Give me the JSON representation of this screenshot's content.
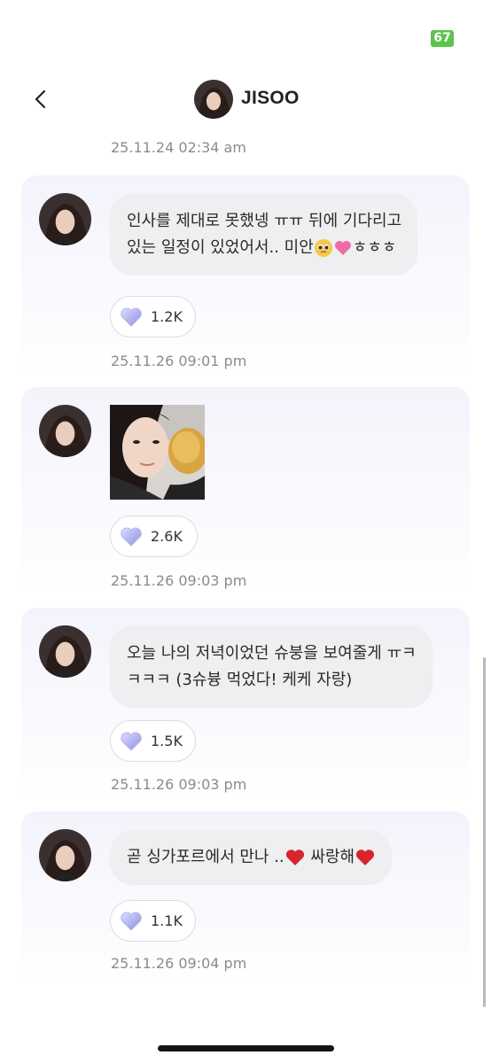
{
  "status": {
    "battery": "67"
  },
  "header": {
    "name": "JISOO"
  },
  "top_timestamp": "25.11.24 02:34 am",
  "messages": [
    {
      "type": "text",
      "lines": [
        "인사를 제대로 못했넹 ㅠㅠ 뒤에 기다리고",
        "있는 일정이 있었어서.. 미안"
      ],
      "tail": "ㅎㅎㅎ",
      "likes": "1.2K",
      "timestamp": "25.11.26 09:01 pm"
    },
    {
      "type": "image",
      "likes": "2.6K",
      "timestamp": "25.11.26 09:03 pm"
    },
    {
      "type": "text",
      "lines": [
        "오늘 나의 저녁이었던 슈붕을 보여줄게 ㅠㅋ",
        "ㅋㅋㅋ (3슈븅 먹었다! 케케 자랑)"
      ],
      "likes": "1.5K",
      "timestamp": "25.11.26 09:03 pm"
    },
    {
      "type": "text",
      "lines": [
        "곧 싱가포르에서 만나 .."
      ],
      "tail": "싸랑해",
      "likes": "1.1K",
      "timestamp": "25.11.26 09:04 pm"
    }
  ],
  "icons": {
    "back": "chevron-left-icon",
    "heart": "crystal-heart-icon",
    "red_heart": "red-heart-icon",
    "pink_heart": "pink-heart-icon",
    "pleading": "pleading-face-icon"
  },
  "colors": {
    "battery": "#5cc44d",
    "bubble": "#efeff1",
    "card": "#f3f3fb"
  }
}
